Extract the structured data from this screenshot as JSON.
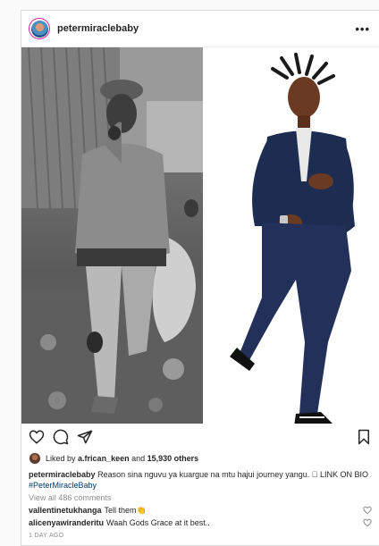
{
  "post": {
    "username": "petermiraclebaby",
    "more_label": "•••",
    "likes": {
      "prefix": "Liked by",
      "user": "a.frican_keen",
      "joiner": "and",
      "count": "15,930 others"
    },
    "caption": {
      "username": "petermiraclebaby",
      "text": "Reason sina nguvu ya kuargue na mtu hajui journey yangu. 🏾 LINK ON BIO",
      "hashtag": "#PeterMiracleBaby"
    },
    "view_all_comments": "View all 486 comments",
    "comments": [
      {
        "username": "vallentinetukhanga",
        "text": "Tell them👏"
      },
      {
        "username": "alicenyawiranderitu",
        "text": "Waah Gods Grace at it best.."
      }
    ],
    "timestamp": "1 DAY AGO"
  },
  "icons": {
    "avatar": "profile-avatar",
    "like": "heart-icon",
    "comment": "comment-icon",
    "share": "share-icon",
    "save": "bookmark-icon",
    "comment_like": "heart-icon"
  },
  "colors": {
    "background": "#fafafa",
    "card": "#ffffff",
    "border": "#dbdbdb",
    "text": "#262626",
    "muted": "#8e8e8e",
    "hashtag": "#00376b"
  }
}
